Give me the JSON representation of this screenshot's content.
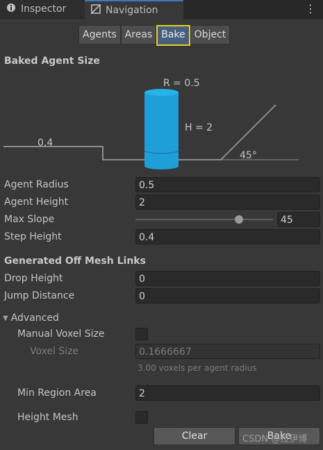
{
  "tabs": [
    {
      "label": "Inspector",
      "icon": "info-icon"
    },
    {
      "label": "Navigation",
      "icon": "navigation-mesh-icon"
    }
  ],
  "modes": [
    "Agents",
    "Areas",
    "Bake",
    "Object"
  ],
  "selected_mode": "Bake",
  "baked_agent_size": {
    "heading": "Baked Agent Size",
    "radius_label": "R = 0.5",
    "height_label": "H = 2",
    "step_label": "0.4",
    "slope_label": "45°"
  },
  "fields": {
    "agent_radius": {
      "label": "Agent Radius",
      "value": "0.5"
    },
    "agent_height": {
      "label": "Agent Height",
      "value": "2"
    },
    "max_slope": {
      "label": "Max Slope",
      "value": "45",
      "slider_fraction": 0.75
    },
    "step_height": {
      "label": "Step Height",
      "value": "0.4"
    }
  },
  "offmesh": {
    "heading": "Generated Off Mesh Links",
    "drop_height": {
      "label": "Drop Height",
      "value": "0"
    },
    "jump_distance": {
      "label": "Jump Distance",
      "value": "0"
    }
  },
  "advanced": {
    "label": "Advanced",
    "manual_voxel_size": {
      "label": "Manual Voxel Size",
      "checked": false
    },
    "voxel_size": {
      "label": "Voxel Size",
      "value": "0.1666667",
      "hint": "3.00 voxels per agent radius"
    },
    "min_region_area": {
      "label": "Min Region Area",
      "value": "2"
    },
    "height_mesh": {
      "label": "Height Mesh",
      "checked": false
    }
  },
  "buttons": {
    "clear": "Clear",
    "bake": "Bake"
  },
  "watermark": "CSDN @拉伊博",
  "colors": {
    "accent_selected": "#46607c",
    "highlight": "#e6cf1f",
    "agent": "#1f9fd8"
  }
}
